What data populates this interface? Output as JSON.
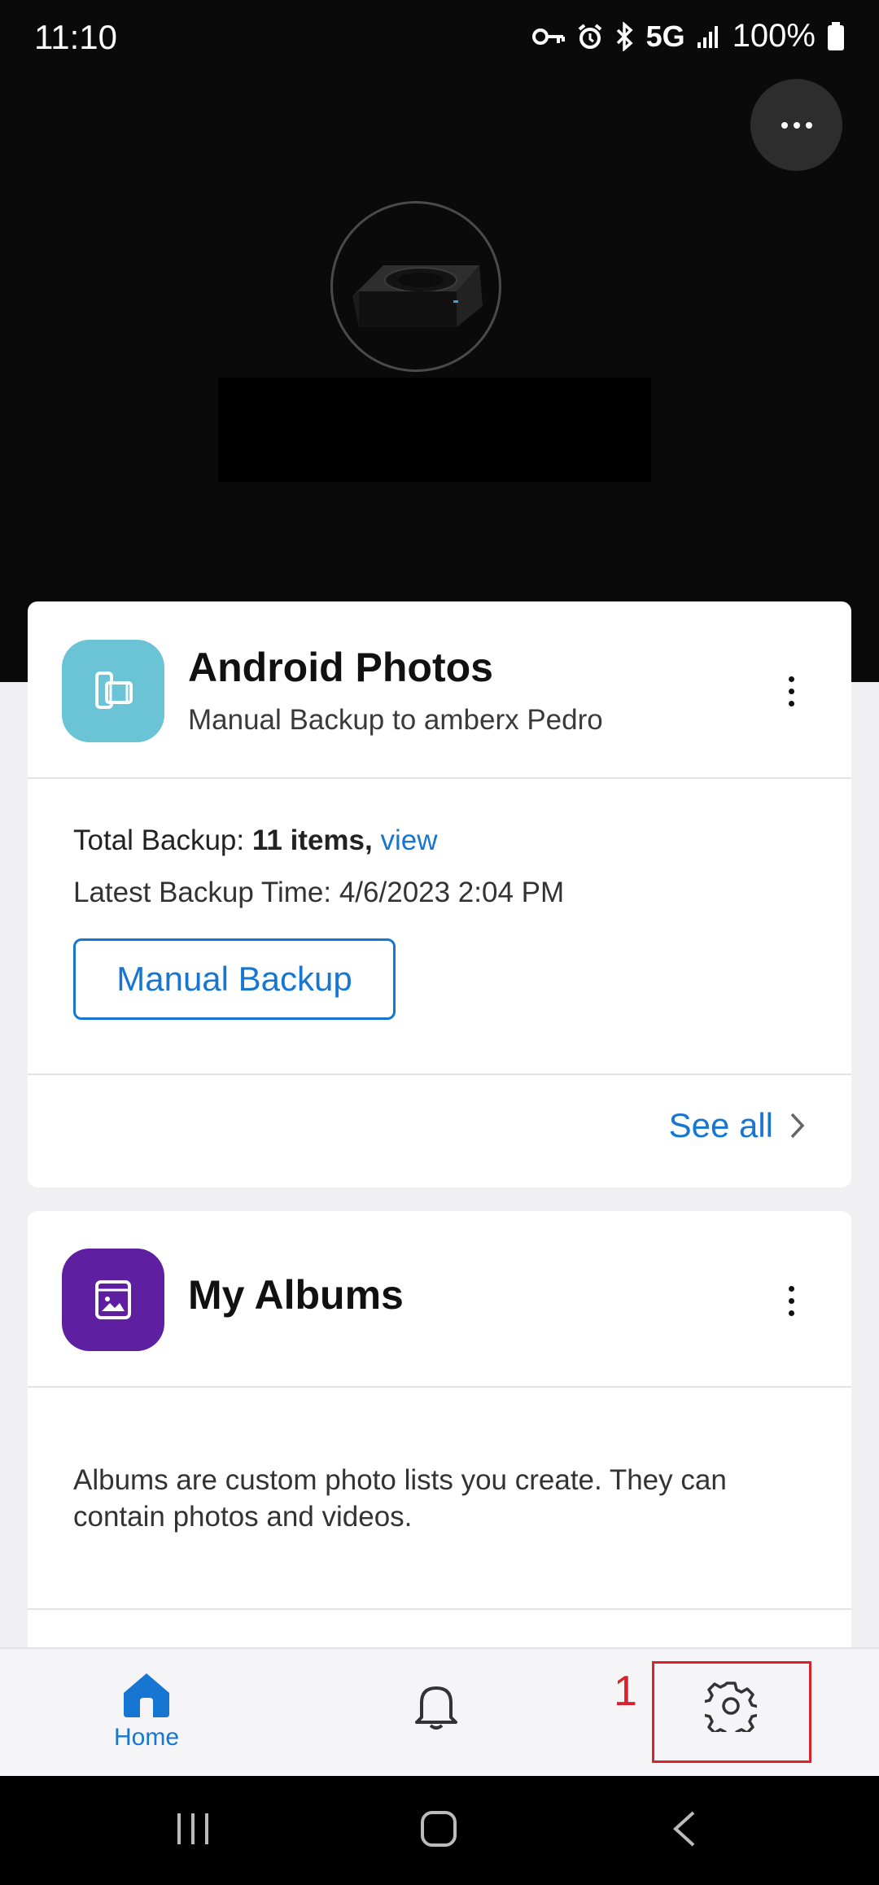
{
  "status_bar": {
    "time": "11:10",
    "network": "5G",
    "battery": "100%"
  },
  "header": {
    "more_icon": "more-horizontal-icon",
    "device_image": "nas-device-image"
  },
  "backup_card": {
    "title": "Android Photos",
    "subtitle": "Manual Backup to amberx Pedro",
    "total_label": "Total Backup:",
    "total_value": "11 items,",
    "view_link": "view",
    "latest_label": "Latest Backup Time:",
    "latest_value": "4/6/2023 2:04 PM",
    "manual_backup_button": "Manual Backup",
    "see_all": "See all",
    "icon": "phone-film-icon",
    "icon_color": "#6bc4d6"
  },
  "albums_card": {
    "title": "My Albums",
    "description": "Albums are custom photo lists you create. They can contain photos and videos.",
    "icon": "album-icon",
    "icon_color": "#5e1fa0"
  },
  "bottom_nav": {
    "home_label": "Home",
    "accent": "#1676d2",
    "items": [
      "home-icon",
      "bell-icon",
      "gear-icon"
    ]
  },
  "annotation": {
    "number": "1",
    "color": "#d9232c"
  }
}
